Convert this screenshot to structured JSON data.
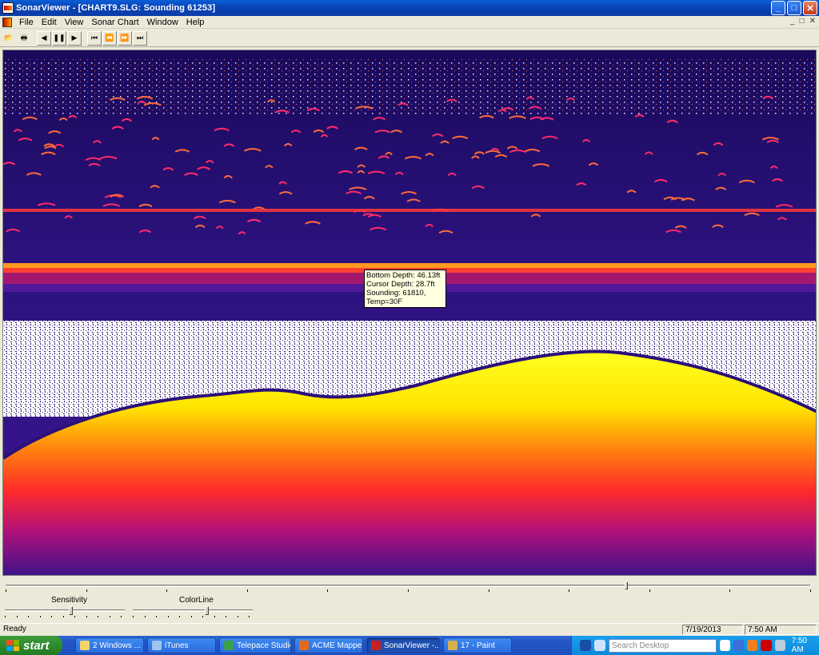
{
  "window": {
    "title": "SonarViewer - [CHART9.SLG: Sounding 61253]",
    "buttons": {
      "minimize": "_",
      "maximize": "□",
      "close": "✕"
    }
  },
  "menu": {
    "items": [
      "File",
      "Edit",
      "View",
      "Sonar Chart",
      "Window",
      "Help"
    ],
    "mdi_buttons": [
      "_",
      "□",
      "✕"
    ]
  },
  "toolbar": {
    "buttons": [
      {
        "icon": "open-folder-icon",
        "glyph": "📂"
      },
      {
        "icon": "print-icon",
        "glyph": "🖶"
      },
      {
        "icon": "step-back-icon",
        "glyph": "◀"
      },
      {
        "icon": "pause-icon",
        "glyph": "❚❚"
      },
      {
        "icon": "play-icon",
        "glyph": "▶"
      },
      {
        "icon": "first-icon",
        "glyph": "⏮"
      },
      {
        "icon": "rewind-icon",
        "glyph": "⏪"
      },
      {
        "icon": "fast-forward-icon",
        "glyph": "⏩"
      },
      {
        "icon": "last-icon",
        "glyph": "⏭"
      }
    ]
  },
  "tooltip": {
    "bottom_depth": "Bottom Depth: 46.13ft",
    "cursor_depth": "Cursor Depth: 28.7ft",
    "sounding": "Sounding: 61810,",
    "temp": "Temp=30F"
  },
  "playback": {
    "position": 0.773
  },
  "controls": {
    "sensitivity": {
      "label": "Sensitivity",
      "value": 0.55
    },
    "colorline": {
      "label": "ColorLine",
      "value": 0.62
    }
  },
  "status": {
    "text": "Ready",
    "date": "7/19/2013",
    "time": "7:50 AM"
  },
  "taskbar": {
    "start": "start",
    "tasks": [
      {
        "label": "2 Windows ...",
        "icon_color": "#f5d36b"
      },
      {
        "label": "iTunes",
        "icon_color": "#9fc4f0"
      },
      {
        "label": "Telepace Studio",
        "icon_color": "#3aa04a"
      },
      {
        "label": "ACME Mappe...",
        "icon_color": "#e56b1c"
      },
      {
        "label": "SonarViewer -...",
        "icon_color": "#c92020",
        "active": true
      },
      {
        "label": "17 - Paint",
        "icon_color": "#d8b050"
      }
    ],
    "search_placeholder": "Search Desktop",
    "clock": "7:50 AM"
  }
}
